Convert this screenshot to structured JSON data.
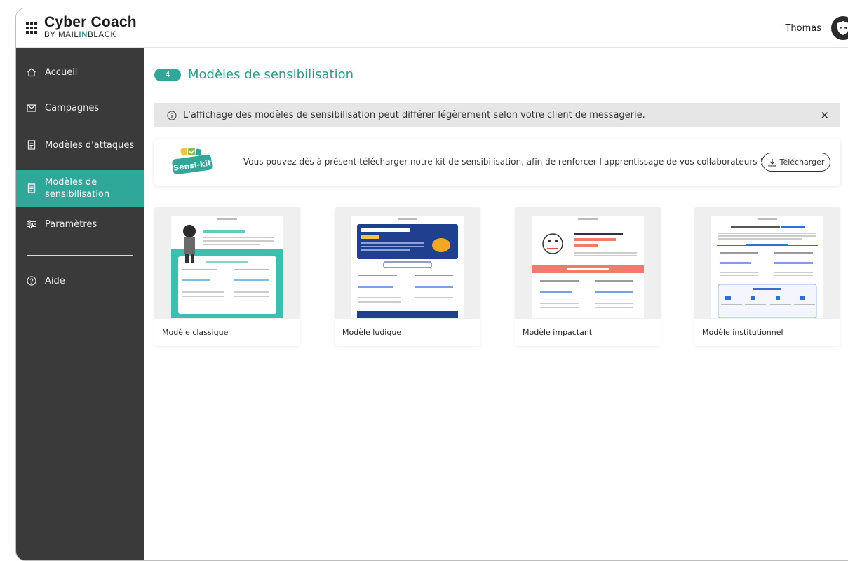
{
  "header": {
    "brand_title": "Cyber Coach",
    "brand_sub_prefix": "BY MAIL",
    "brand_sub_accent": "IN",
    "brand_sub_suffix": "BLACK",
    "user_name": "Thomas"
  },
  "sidebar": {
    "items": [
      {
        "label": "Accueil",
        "icon": "home-icon"
      },
      {
        "label": "Campagnes",
        "icon": "mail-icon"
      },
      {
        "label": "Modèles d'attaques",
        "icon": "document-icon"
      },
      {
        "label": "Modèles de sensibilisation",
        "icon": "document-icon",
        "active": true
      },
      {
        "label": "Paramètres",
        "icon": "sliders-icon"
      },
      {
        "label": "Aide",
        "icon": "help-icon"
      }
    ]
  },
  "main": {
    "count": "4",
    "title": "Modèles de sensibilisation",
    "info_message": "L'affichage des modèles de sensibilisation peut différer légèrement selon votre client de messagerie.",
    "kit_logo_text": "Sensi-kit",
    "kit_message": "Vous pouvez dès à présent télécharger notre kit de sensibilisation, afin de renforcer l'apprentissage de vos collaborateurs !",
    "download_label": "Télécharger",
    "cards": [
      {
        "label": "Modèle classique"
      },
      {
        "label": "Modèle ludique"
      },
      {
        "label": "Modèle impactant"
      },
      {
        "label": "Modèle institutionnel"
      }
    ]
  },
  "colors": {
    "accent": "#2fa89a",
    "sidebar_bg": "#3a3a3a",
    "ludique_blue": "#1f3f8f",
    "impactant_red": "#f07a6b"
  }
}
